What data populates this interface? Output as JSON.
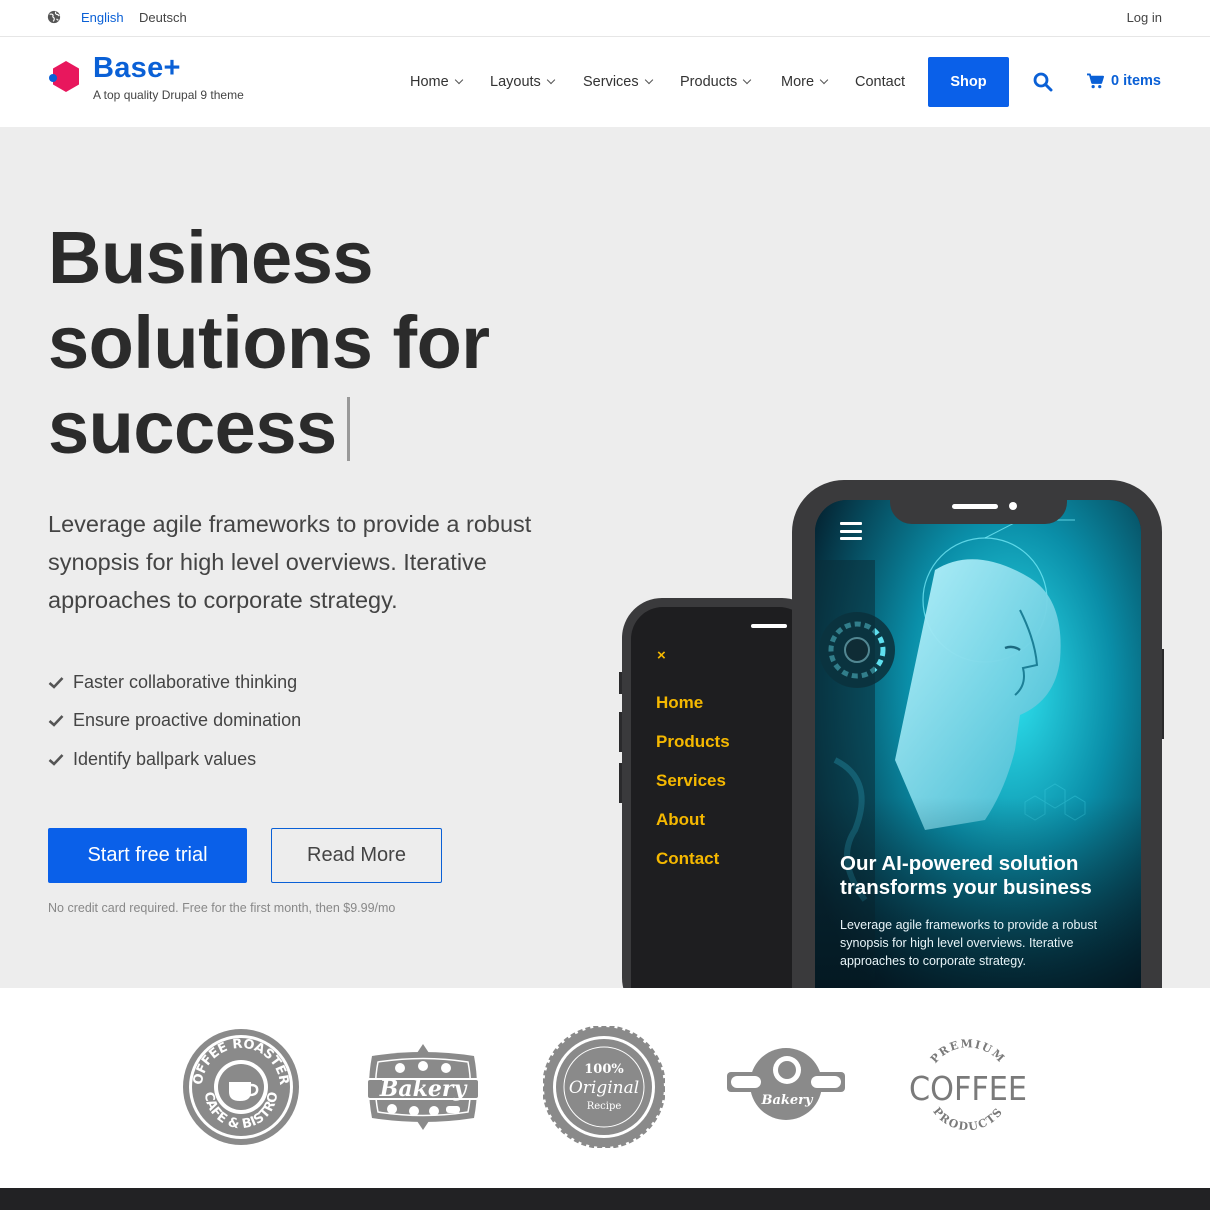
{
  "topbar": {
    "languages": [
      {
        "label": "English",
        "active": true
      },
      {
        "label": "Deutsch",
        "active": false
      }
    ],
    "login_label": "Log in"
  },
  "header": {
    "brand": "Base+",
    "tagline": "A top quality Drupal 9 theme",
    "nav": [
      {
        "label": "Home",
        "has_dropdown": true
      },
      {
        "label": "Layouts",
        "has_dropdown": true
      },
      {
        "label": "Services",
        "has_dropdown": true
      },
      {
        "label": "Products",
        "has_dropdown": true
      },
      {
        "label": "More",
        "has_dropdown": true
      },
      {
        "label": "Contact",
        "has_dropdown": false
      }
    ],
    "shop_label": "Shop",
    "cart_label": "0 items",
    "icons": {
      "search": "search-icon",
      "cart": "cart-icon",
      "language": "globe-icon"
    }
  },
  "hero": {
    "title_lines": [
      "Business",
      "solutions for",
      "success"
    ],
    "lead": "Leverage agile frameworks to provide a robust synopsis for high level overviews. Iterative approaches to corporate strategy.",
    "features": [
      "Faster collaborative thinking",
      "Ensure proactive domination",
      "Identify ballpark values"
    ],
    "primary_cta": "Start free trial",
    "secondary_cta": "Read More",
    "fine_print": "No credit card required. Free for the first month, then $9.99/mo"
  },
  "mockup": {
    "close_glyph": "×",
    "mobile_menu": [
      "Home",
      "Products",
      "Services",
      "About",
      "Contact"
    ],
    "screen_title": "Our AI-powered solution transforms your business",
    "screen_body": "Leverage agile frameworks to provide a robust synopsis for high level overviews. Iterative approaches to corporate strategy."
  },
  "client_logos": [
    {
      "name": "coffee-roasters",
      "top_text": "COFFEE ROASTERS",
      "bottom_text": "CAFE & BISTRO"
    },
    {
      "name": "bakery",
      "text": "Bakery"
    },
    {
      "name": "original-recipe",
      "line1": "100%",
      "line2": "Original",
      "line3": "Recipe"
    },
    {
      "name": "bakery-banner",
      "text": "Bakery"
    },
    {
      "name": "premium-coffee",
      "top_text": "PREMIUM",
      "main_text": "COFFEE",
      "bottom_text": "PRODUCTS"
    }
  ],
  "colors": {
    "brand_blue": "#0a60e9",
    "hero_bg": "#ededed",
    "menu_yellow": "#f5b800",
    "logo_gray": "#8a8a8a"
  }
}
